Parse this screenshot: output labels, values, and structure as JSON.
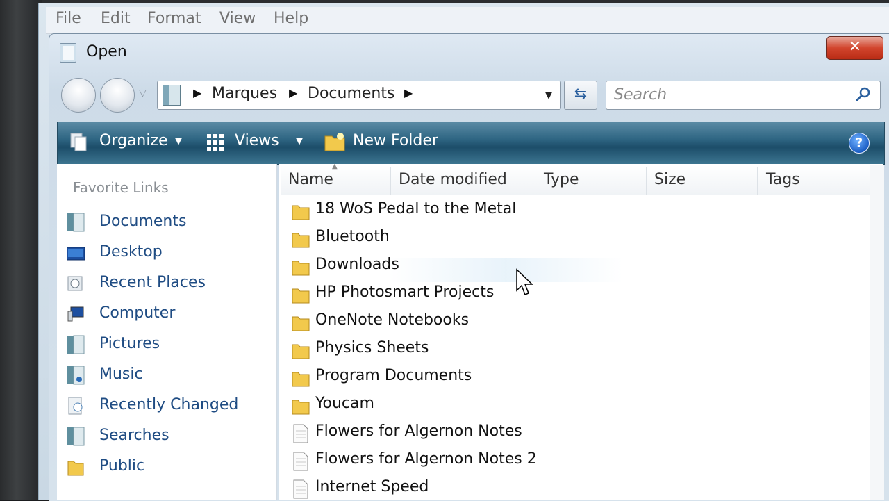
{
  "menubar": {
    "items": [
      "File",
      "Edit",
      "Format",
      "View",
      "Help"
    ]
  },
  "dialog": {
    "title": "Open",
    "close_label": "✕"
  },
  "address": {
    "segments": [
      "Marques",
      "Documents"
    ]
  },
  "search": {
    "placeholder": "Search"
  },
  "toolbar": {
    "organize_label": "Organize",
    "views_label": "Views",
    "new_folder_label": "New Folder",
    "help_label": "?"
  },
  "sidebar": {
    "heading": "Favorite Links",
    "items": [
      {
        "label": "Documents",
        "icon": "documents-icon"
      },
      {
        "label": "Desktop",
        "icon": "desktop-icon"
      },
      {
        "label": "Recent Places",
        "icon": "recent-places-icon"
      },
      {
        "label": "Computer",
        "icon": "computer-icon"
      },
      {
        "label": "Pictures",
        "icon": "pictures-icon"
      },
      {
        "label": "Music",
        "icon": "music-icon"
      },
      {
        "label": "Recently Changed",
        "icon": "recently-changed-icon"
      },
      {
        "label": "Searches",
        "icon": "searches-icon"
      },
      {
        "label": "Public",
        "icon": "folder-icon"
      }
    ]
  },
  "file_list": {
    "columns": [
      "Name",
      "Date modified",
      "Type",
      "Size",
      "Tags"
    ],
    "rows": [
      {
        "name": "18 WoS Pedal to the Metal",
        "kind": "folder"
      },
      {
        "name": "Bluetooth",
        "kind": "folder"
      },
      {
        "name": "Downloads",
        "kind": "folder"
      },
      {
        "name": "HP Photosmart Projects",
        "kind": "folder"
      },
      {
        "name": "OneNote Notebooks",
        "kind": "folder"
      },
      {
        "name": "Physics Sheets",
        "kind": "folder"
      },
      {
        "name": "Program Documents",
        "kind": "folder"
      },
      {
        "name": "Youcam",
        "kind": "folder"
      },
      {
        "name": "Flowers for Algernon Notes",
        "kind": "document"
      },
      {
        "name": "Flowers for Algernon Notes 2",
        "kind": "document"
      },
      {
        "name": "Internet Speed",
        "kind": "document"
      }
    ]
  },
  "colors": {
    "command_bar": "#2f6683",
    "link_text": "#1f4c83",
    "folder_yellow": "#f2c94c"
  }
}
